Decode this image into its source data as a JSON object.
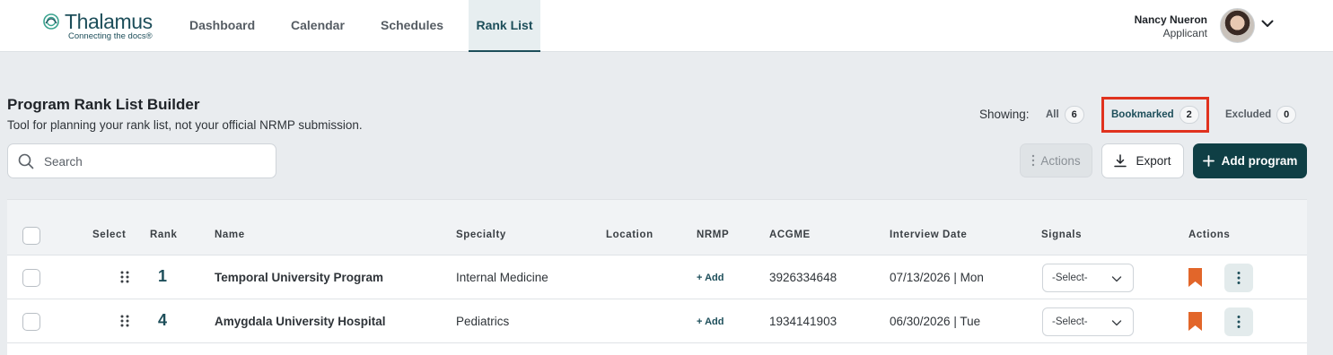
{
  "brand": {
    "name": "Thalamus",
    "tagline": "Connecting the docs®"
  },
  "nav": [
    {
      "label": "Dashboard",
      "active": false
    },
    {
      "label": "Calendar",
      "active": false
    },
    {
      "label": "Schedules",
      "active": false
    },
    {
      "label": "Rank List",
      "active": true
    }
  ],
  "user": {
    "name": "Nancy Nueron",
    "role": "Applicant"
  },
  "page": {
    "title": "Program Rank List Builder",
    "subtitle": "Tool for planning your rank list, not your official NRMP submission."
  },
  "filters": {
    "showing_label": "Showing:",
    "all": {
      "label": "All",
      "count": "6"
    },
    "bookmarked": {
      "label": "Bookmarked",
      "count": "2",
      "highlighted": true
    },
    "excluded": {
      "label": "Excluded",
      "count": "0"
    }
  },
  "search": {
    "placeholder": "Search",
    "value": ""
  },
  "toolbar": {
    "actions_label": "Actions",
    "export_label": "Export",
    "add_label": "Add program"
  },
  "table": {
    "headers": {
      "select": "Select",
      "rank": "Rank",
      "name": "Name",
      "specialty": "Specialty",
      "location": "Location",
      "nrmp": "NRMP",
      "acgme": "ACGME",
      "interview_date": "Interview Date",
      "signals": "Signals",
      "actions": "Actions"
    },
    "rows": [
      {
        "rank": "1",
        "name": "Temporal University Program",
        "specialty": "Internal Medicine",
        "location": "",
        "nrmp": "+ Add",
        "acgme": "3926334648",
        "interview_date": "07/13/2026 | Mon",
        "signal": "-Select-",
        "bookmarked": true
      },
      {
        "rank": "4",
        "name": "Amygdala University Hospital",
        "specialty": "Pediatrics",
        "location": "",
        "nrmp": "+ Add",
        "acgme": "1934141903",
        "interview_date": "06/30/2026 | Tue",
        "signal": "-Select-",
        "bookmarked": true
      }
    ]
  },
  "colors": {
    "brand_teal": "#1d4e5a",
    "primary_button": "#0f3f45",
    "bookmark": "#e2662a",
    "highlight_box": "#e0321e",
    "page_bg": "#e9ecef"
  }
}
